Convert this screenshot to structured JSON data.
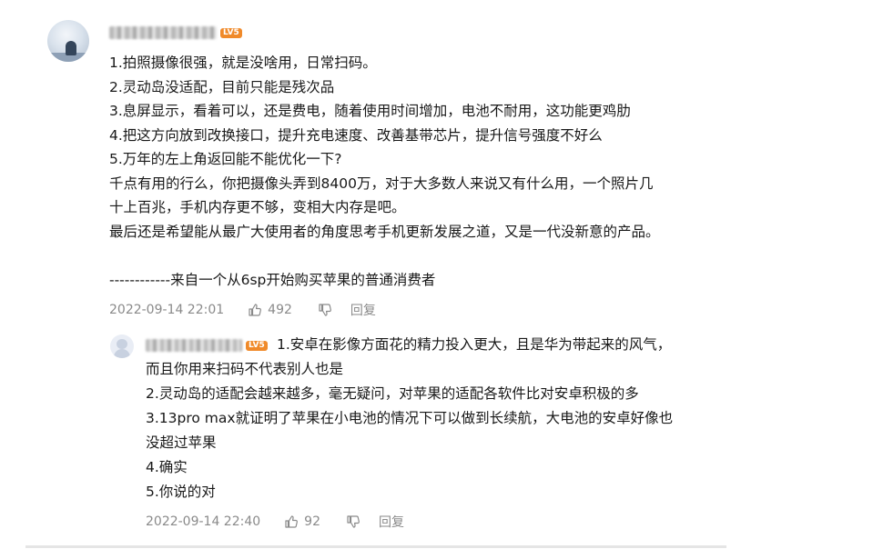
{
  "comment": {
    "level_badge": "LV5",
    "lines": [
      "1.拍照摄像很强，就是没啥用，日常扫码。",
      "2.灵动岛没适配，目前只能是残次品",
      "3.息屏显示，看着可以，还是费电，随着使用时间增加，电池不耐用，这功能更鸡肋",
      "4.把这方向放到改换接口，提升充电速度、改善基带芯片，提升信号强度不好么",
      "5.万年的左上角返回能不能优化一下?",
      "千点有用的行么，你把摄像头弄到8400万，对于大多数人来说又有什么用，一个照片几",
      "十上百兆，手机内存更不够，变相大内存是吧。",
      "最后还是希望能从最广大使用者的角度思考手机更新发展之道，又是一代没新意的产品。",
      "",
      "------------来自一个从6sp开始购买苹果的普通消费者"
    ],
    "timestamp": "2022-09-14 22:01",
    "like_count": "492",
    "reply_label": "回复"
  },
  "reply": {
    "level_badge": "LV5",
    "first_line": "1.安卓在影像方面花的精力投入更大，且是华为带起来的风气，",
    "lines": [
      "而且你用来扫码不代表别人也是",
      "2.灵动岛的适配会越来越多，毫无疑问，对苹果的适配各软件比对安卓积极的多",
      "3.13pro max就证明了苹果在小电池的情况下可以做到长续航，大电池的安卓好像也",
      "没超过苹果",
      "4.确实",
      "5.你说的对"
    ],
    "timestamp": "2022-09-14 22:40",
    "like_count": "92",
    "reply_label": "回复"
  },
  "icons": {
    "like": "thumbs-up-icon",
    "dislike": "thumbs-down-icon"
  },
  "colors": {
    "text": "#181818",
    "meta": "#8a8a8a",
    "badge": "#f08a2a"
  }
}
